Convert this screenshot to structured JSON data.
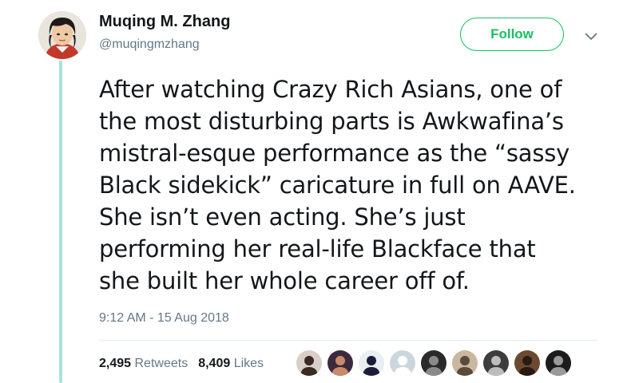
{
  "author": {
    "display_name": "Muqing M. Zhang",
    "handle": "@muqingmzhang"
  },
  "follow_label": "Follow",
  "tweet": {
    "text": "After watching Crazy Rich Asians, one of\nthe most disturbing parts is Awkwafina’s\nmistral-esque performance as the “sassy\nBlack sidekick” caricature in full on AAVE.\nShe isn’t even acting. She’s just\nperforming her real-life Blackface that\nshe built her whole career off of.",
    "timestamp": "9:12 AM - 15 Aug 2018"
  },
  "stats": {
    "retweets_count": "2,495",
    "retweets_label": "Retweets",
    "likes_count": "8,409",
    "likes_label": "Likes"
  },
  "icons": {
    "caret": "chevron-down-icon"
  },
  "colors": {
    "follow_green": "#17bf63",
    "thread_line": "#a9e2d8",
    "secondary_text": "#657786"
  },
  "liker_avatars": [
    {
      "bg": "#d8d0c8",
      "fg": "#3a2a22"
    },
    {
      "bg": "#3b2a3f",
      "fg": "#c98a6a"
    },
    {
      "bg": "#e8eef2",
      "fg": "#1b1d3a"
    },
    {
      "bg": "#ccd6dd",
      "fg": "#ffffff"
    },
    {
      "bg": "#2a2a2a",
      "fg": "#8a8a8a"
    },
    {
      "bg": "#c9b7a0",
      "fg": "#5a4a3a"
    },
    {
      "bg": "#3d3d3d",
      "fg": "#bdbdbd"
    },
    {
      "bg": "#6b4a32",
      "fg": "#2b1a12"
    },
    {
      "bg": "#1c1c1c",
      "fg": "#9a9a9a"
    }
  ]
}
